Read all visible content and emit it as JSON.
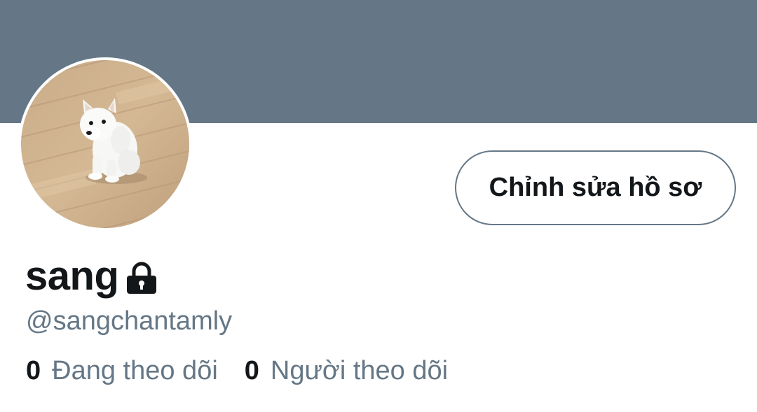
{
  "profile": {
    "banner_color": "#657786",
    "avatar_description_icon": "white-puppy-photo",
    "edit_button_label": "Chỉnh sửa hồ sơ",
    "display_name": "sang",
    "protected_icon": "lock-icon",
    "handle": "@sangchantamly",
    "following": {
      "count": "0",
      "label": "Đang theo dõi"
    },
    "followers": {
      "count": "0",
      "label": "Người theo dõi"
    }
  },
  "colors": {
    "primary_text": "#14171a",
    "secondary_text": "#657786",
    "border": "#657786",
    "background": "#ffffff"
  }
}
